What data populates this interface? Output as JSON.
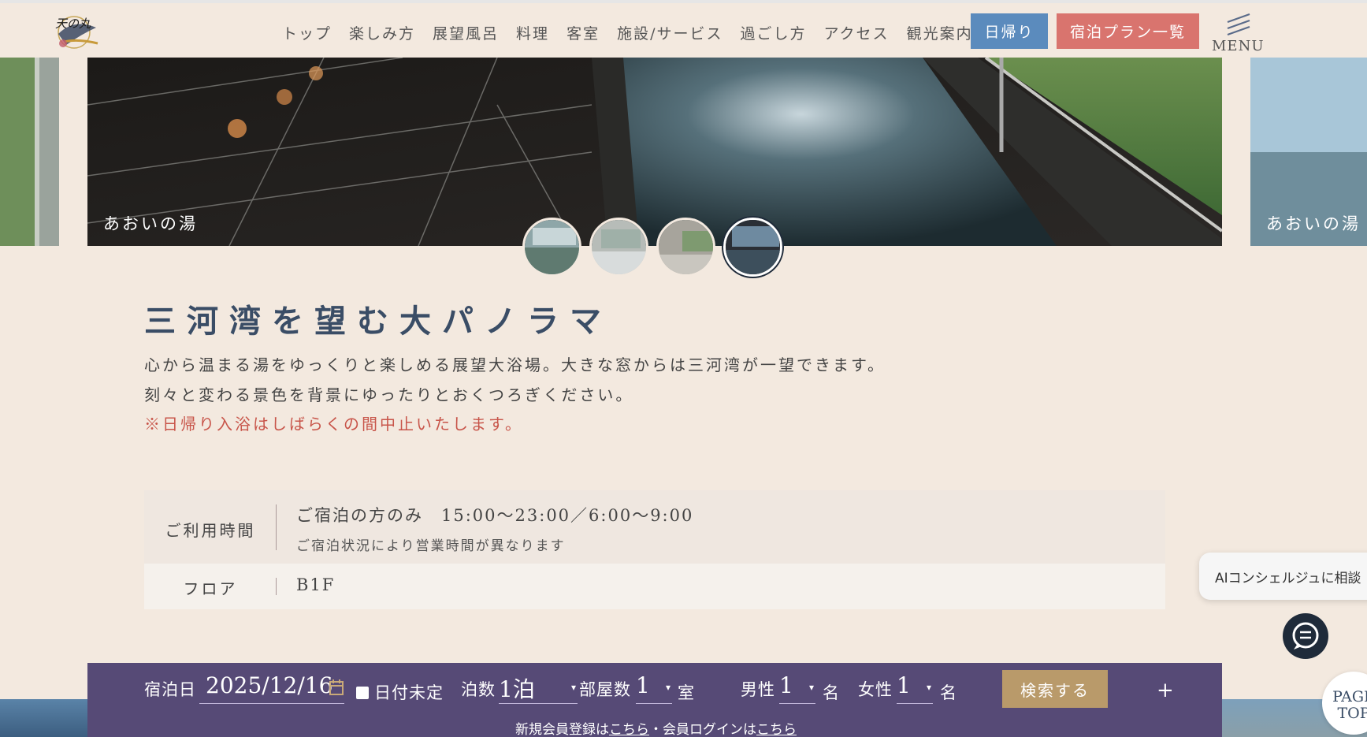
{
  "header": {
    "logo_text": "天の丸",
    "nav": [
      "トップ",
      "楽しみ方",
      "展望風呂",
      "料理",
      "客室",
      "施設/サービス",
      "過ごし方",
      "アクセス",
      "観光案内"
    ],
    "day_trip_label": "日帰り",
    "plans_label": "宿泊プラン一覧",
    "menu_label": "MENU"
  },
  "slider": {
    "caption_main": "あおいの湯",
    "caption_right": "あおいの湯",
    "thumb_count": 4,
    "active_thumb": 4
  },
  "content": {
    "heading": "三河湾を望む大パノラマ",
    "para1": "心から温まる湯をゆっくりと楽しめる展望大浴場。大きな窓からは三河湾が一望できます。",
    "para2": "刻々と変わる景色を背景にゆったりとおくつろぎください。",
    "notice": "※日帰り入浴はしばらくの間中止いたします。"
  },
  "info": {
    "hours_label": "ご利用時間",
    "hours_value": "ご宿泊の方のみ　15:00～23:00／6:00～9:00",
    "hours_note": "ご宿泊状況により営業時間が異なります",
    "floor_label": "フロア",
    "floor_value": "B1F"
  },
  "search": {
    "date_label": "宿泊日",
    "date_value": "2025/12/16",
    "undecided_label": "日付未定",
    "nights_label": "泊数",
    "nights_value": "1泊",
    "rooms_label": "部屋数",
    "rooms_value": "1",
    "rooms_unit": "室",
    "male_label": "男性",
    "male_value": "1",
    "male_unit": "名",
    "female_label": "女性",
    "female_value": "1",
    "female_unit": "名",
    "submit_label": "検索する",
    "expand_label": "+",
    "register_text": "新規会員登録は",
    "register_link": "こちら",
    "separator": "・",
    "login_text": "会員ログインは",
    "login_link": "こちら"
  },
  "floating": {
    "ai_label": "AIコンシェルジュに相談",
    "pagetop_line1": "PAGE",
    "pagetop_line2": "TOP"
  },
  "colors": {
    "background": "#f3e9df",
    "day_trip": "#5b8bbd",
    "plans": "#d9746e",
    "search_bar": "#564a76",
    "submit": "#b99a6a",
    "notice": "#c8554a"
  }
}
